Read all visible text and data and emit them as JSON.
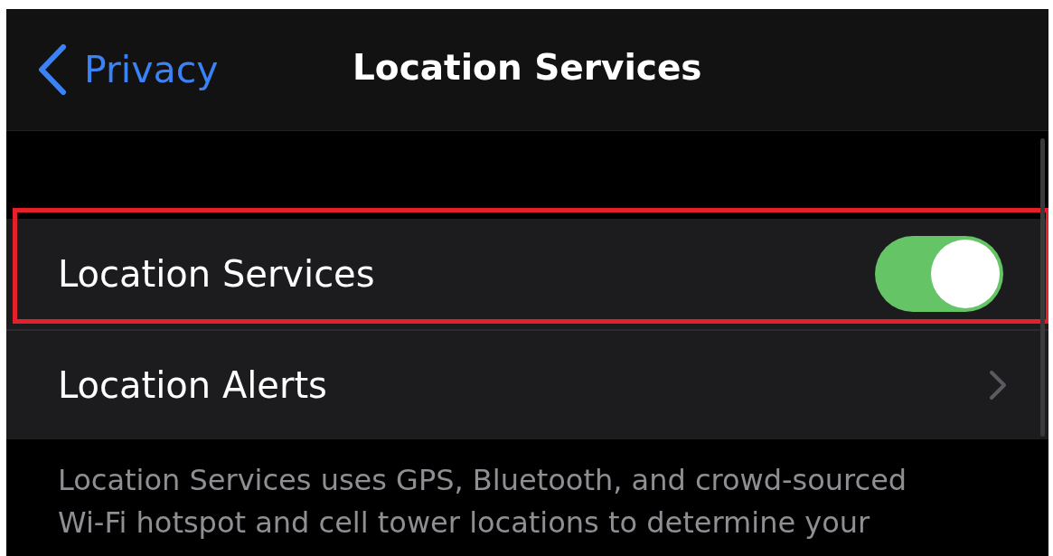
{
  "nav": {
    "back_label": "Privacy",
    "title": "Location Services"
  },
  "rows": [
    {
      "kind": "toggle",
      "label": "Location Services",
      "on": true,
      "highlighted": true
    },
    {
      "kind": "link",
      "label": "Location Alerts",
      "highlighted": false
    }
  ],
  "footer": "Location Services uses GPS, Bluetooth, and crowd-sourced Wi-Fi hotspot and cell tower locations to determine your"
}
